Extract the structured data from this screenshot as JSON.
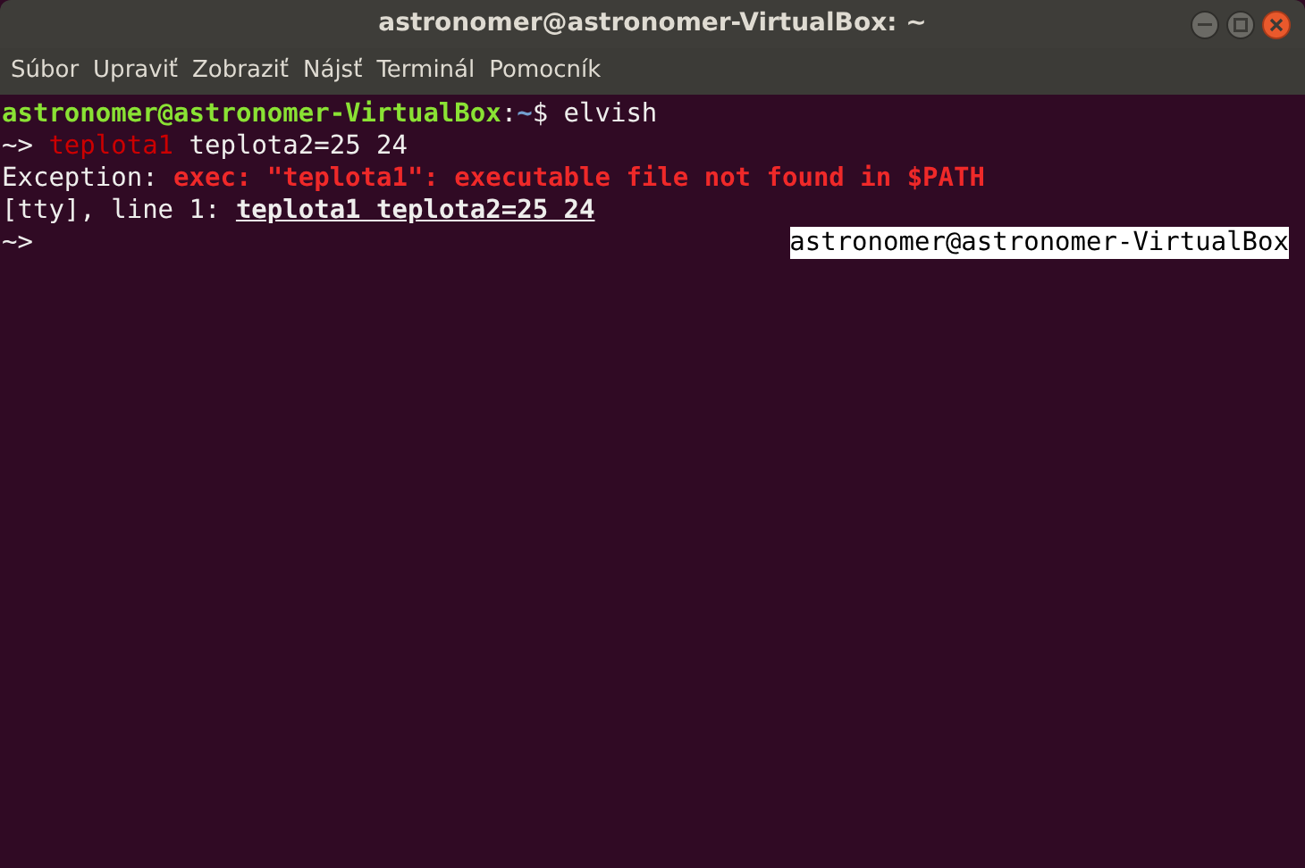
{
  "window": {
    "title": "astronomer@astronomer-VirtualBox: ~"
  },
  "menu": [
    "Súbor",
    "Upraviť",
    "Zobraziť",
    "Nájsť",
    "Terminál",
    "Pomocník"
  ],
  "terminal": {
    "lines": [
      {
        "segments": [
          {
            "kind": "user",
            "text": "astronomer@astronomer-VirtualBox"
          },
          {
            "kind": "plain",
            "text": ":"
          },
          {
            "kind": "path",
            "text": "~"
          },
          {
            "kind": "plain",
            "text": "$ elvish"
          }
        ]
      },
      {
        "segments": [
          {
            "kind": "plain",
            "text": "~> "
          },
          {
            "kind": "badcmd",
            "text": "teplota1"
          },
          {
            "kind": "plain",
            "text": " teplota2=25 24"
          }
        ]
      },
      {
        "segments": [
          {
            "kind": "plain",
            "text": "Exception: "
          },
          {
            "kind": "error",
            "text": "exec: \"teplota1\": executable file not found in $PATH"
          }
        ]
      },
      {
        "segments": [
          {
            "kind": "plain",
            "text": "[tty], line 1: "
          },
          {
            "kind": "underline",
            "text": "teplota1 teplota2=25 24"
          }
        ]
      },
      {
        "segments": [
          {
            "kind": "plain",
            "text": "~>"
          }
        ],
        "rprompt": "astronomer@astronomer-VirtualBox"
      }
    ]
  }
}
